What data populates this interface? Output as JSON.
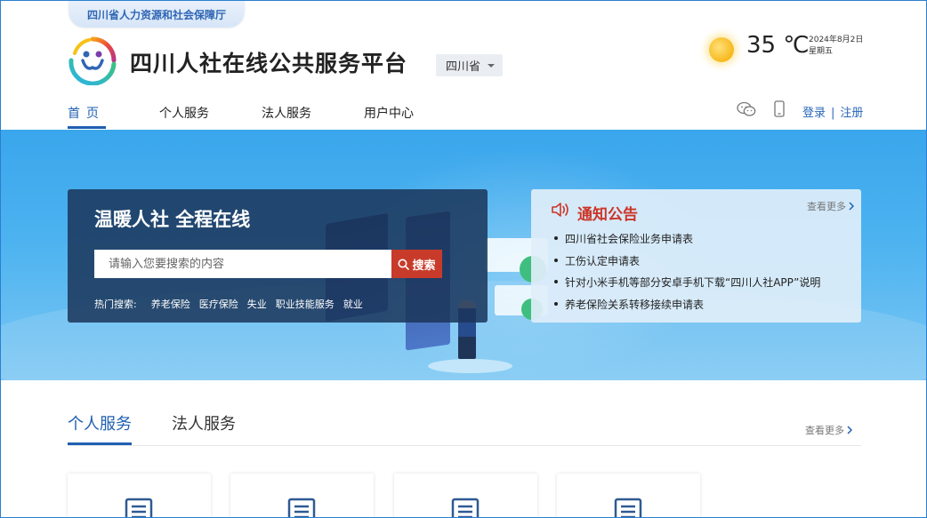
{
  "header": {
    "dept": "四川省人力资源和社会保障厅",
    "title": "四川人社在线公共服务平台",
    "region": "四川省"
  },
  "weather": {
    "temp": "35 ℃",
    "date": "2024年8月2日",
    "weekday": "星期五"
  },
  "nav": {
    "items": [
      "首页",
      "个人服务",
      "法人服务",
      "用户中心"
    ]
  },
  "auth": {
    "login": "登录",
    "sep": "|",
    "register": "注册"
  },
  "banner": {
    "slogan": "温暖人社 全程在线",
    "search_placeholder": "请输入您要搜索的内容",
    "search_button": "搜索",
    "hot_label": "热门搜索:",
    "hot_items": [
      "养老保险",
      "医疗保险",
      "失业",
      "职业技能服务",
      "就业"
    ]
  },
  "notice": {
    "title": "通知公告",
    "more": "查看更多",
    "items": [
      "四川省社会保险业务申请表",
      "工伤认定申请表",
      "针对小米手机等部分安卓手机下载“四川人社APP”说明",
      "养老保险关系转移接续申请表"
    ]
  },
  "services": {
    "tabs": [
      "个人服务",
      "法人服务"
    ],
    "more": "查看更多"
  },
  "colors": {
    "brand_blue": "#1f5fb2",
    "search_red": "#c83b2a",
    "notice_red": "#cc3527"
  }
}
